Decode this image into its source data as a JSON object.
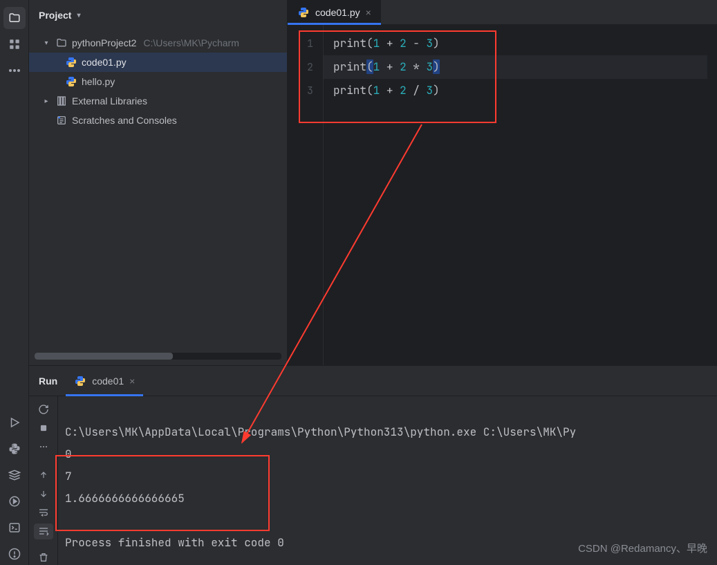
{
  "project": {
    "header": "Project",
    "root": {
      "name": "pythonProject2",
      "path": "C:\\Users\\MK\\Pycharm"
    },
    "files": [
      {
        "name": "code01.py",
        "selected": true
      },
      {
        "name": "hello.py",
        "selected": false
      }
    ],
    "external": "External Libraries",
    "scratches": "Scratches and Consoles"
  },
  "editor": {
    "tab": {
      "name": "code01.py"
    },
    "lines": [
      {
        "n": "1",
        "fn": "print",
        "a": "1",
        "op1": "+",
        "b": "2",
        "op2": "-",
        "c": "3"
      },
      {
        "n": "2",
        "fn": "print",
        "a": "1",
        "op1": "+",
        "b": "2",
        "op2": "*",
        "c": "3"
      },
      {
        "n": "3",
        "fn": "print",
        "a": "1",
        "op1": "+",
        "b": "2",
        "op2": "/",
        "c": "3"
      }
    ]
  },
  "run": {
    "title": "Run",
    "tabName": "code01",
    "cmd": "C:\\Users\\MK\\AppData\\Local\\Programs\\Python\\Python313\\python.exe C:\\Users\\MK\\Py",
    "out1": "0",
    "out2": "7",
    "out3": "1.6666666666666665",
    "exit": "Process finished with exit code 0"
  },
  "watermark": "CSDN @Redamancy、早晚"
}
